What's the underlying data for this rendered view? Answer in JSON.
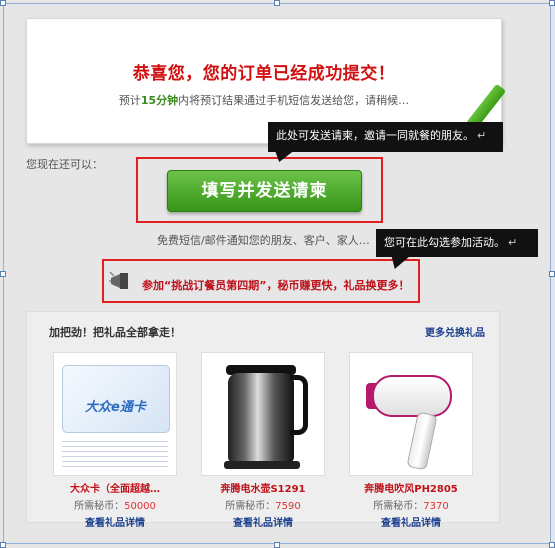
{
  "confirm": {
    "title": "恭喜您，您的订单已经成功提交！",
    "sub_prefix": "预计",
    "sub_highlight": "15分钟",
    "sub_suffix": "内将预订结果通过手机短信发送给您，请稍候…"
  },
  "actions": {
    "now_label": "您现在还可以：",
    "invite_button": "填写并发送请柬",
    "notify_text": "免费短信/邮件通知您的朋友、客户、家人…"
  },
  "promo": {
    "link": "参加“挑战订餐员第四期”，秘币赚更快，礼品换更多！"
  },
  "annotations": {
    "tip1": "此处可发送请柬，邀请一同就餐的朋友。",
    "tip2": "您可在此勾选参加活动。",
    "return_mark": "↵"
  },
  "gifts": {
    "title": "加把劲！把礼品全部拿走！",
    "more_link": "更多兑换礼品",
    "price_prefix": "所需秘币：",
    "detail_label": "查看礼品详情",
    "items": [
      {
        "name": "大众卡（全面超越…",
        "price": "50000",
        "card_text": "大众e通卡"
      },
      {
        "name": "奔腾电水壶S1291",
        "price": "7590"
      },
      {
        "name": "奔腾电吹风PH2805",
        "price": "7370"
      }
    ]
  },
  "colors": {
    "accent_red": "#d10f10",
    "button_green": "#38961a",
    "link_blue": "#1a3f8f"
  }
}
